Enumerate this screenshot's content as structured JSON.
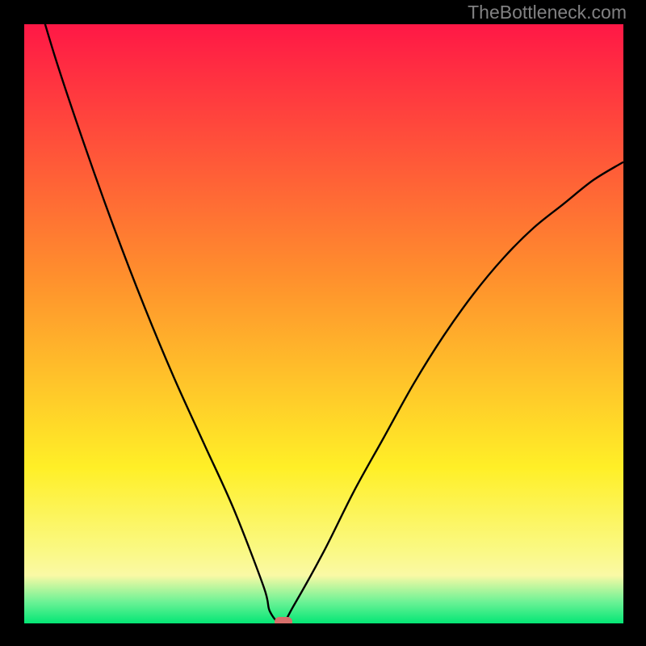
{
  "attribution": "TheBottleneck.com",
  "colors": {
    "frame": "#000000",
    "red": "#ff1846",
    "orange": "#ff8f2d",
    "yellow": "#ffef27",
    "yellow_pale": "#faf985",
    "yellow_soft": "#faf9a5",
    "green_light": "#69f295",
    "green": "#04e675",
    "marker": "#d66f6b",
    "curve": "#000000",
    "text": "#818182"
  },
  "chart_data": {
    "type": "line",
    "title": "",
    "xlabel": "",
    "ylabel": "",
    "xlim": [
      0,
      100
    ],
    "ylim": [
      0,
      100
    ],
    "series": [
      {
        "name": "bottleneck-curve",
        "x": [
          0,
          5,
          10,
          15,
          20,
          25,
          30,
          35,
          40,
          41,
          43,
          45,
          50,
          55,
          60,
          65,
          70,
          75,
          80,
          85,
          90,
          95,
          100
        ],
        "values": [
          112,
          95,
          80,
          66,
          53,
          41,
          30,
          19,
          6,
          2,
          0,
          3,
          12,
          22,
          31,
          40,
          48,
          55,
          61,
          66,
          70,
          74,
          77
        ]
      }
    ],
    "marker": {
      "x": 43.2,
      "y": 0
    },
    "gradient_stops": [
      {
        "pos": 0,
        "color": "#ff1846"
      },
      {
        "pos": 0.42,
        "color": "#ff8f2d"
      },
      {
        "pos": 0.74,
        "color": "#ffef27"
      },
      {
        "pos": 0.88,
        "color": "#faf985"
      },
      {
        "pos": 0.92,
        "color": "#faf9a5"
      },
      {
        "pos": 0.965,
        "color": "#69f295"
      },
      {
        "pos": 1.0,
        "color": "#04e675"
      }
    ]
  }
}
